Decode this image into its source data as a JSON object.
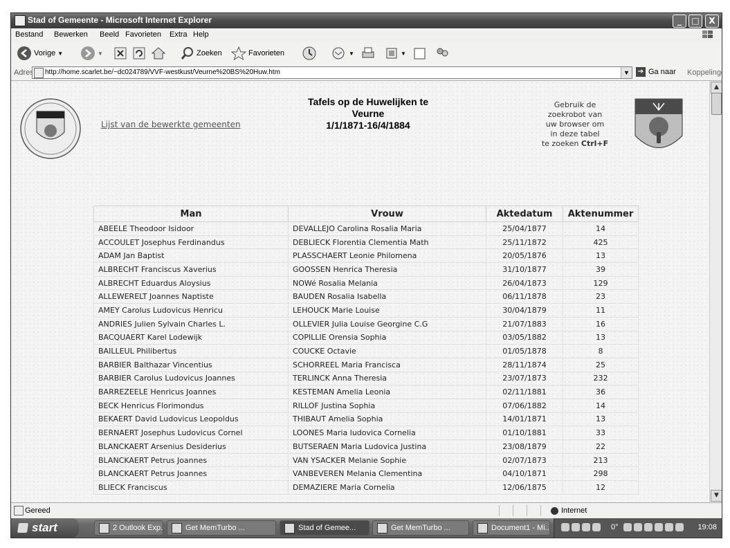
{
  "window": {
    "title": "Stad of  Gemeente - Microsoft Internet Explorer",
    "controls": {
      "minimize": "_",
      "maximize": "□",
      "close": "X"
    }
  },
  "menu": [
    "Bestand",
    "Bewerken",
    "Beeld",
    "Favorieten",
    "Extra",
    "Help"
  ],
  "toolbar": {
    "back_label": "Vorige",
    "search_label": "Zoeken",
    "favorites_label": "Favorieten"
  },
  "address": {
    "label": "Adres",
    "url": "http://home.scarlet.be/~dc024789/VVF-westkust/Veurne%20BS%20Huw.htm",
    "go_label": "Ga naar",
    "links_label": "Koppelingen"
  },
  "page": {
    "link_text": "Lijst van de bewerkte gemeenten",
    "title_line1": "Tafels op de Huwelijken te",
    "title_line2": "Veurne",
    "title_line3": "1/1/1871-16/4/1884",
    "hint_lines": [
      "Gebruik de",
      "zoekrobot van",
      "uw browser om",
      "in deze tabel"
    ],
    "hint_last_prefix": "te zoeken ",
    "hint_shortcut": "Ctrl+F",
    "logo_left_text": "SVVF"
  },
  "table": {
    "headers": [
      "Man",
      "Vrouw",
      "Aktedatum",
      "Aktenummer"
    ],
    "rows": [
      [
        "ABEELE Theodoor Isidoor",
        "DEVALLEJO Carolina Rosalia Maria",
        "25/04/1877",
        "14"
      ],
      [
        "ACCOULET Josephus Ferdinandus",
        "DEBLIECK Florentia Clementia Math",
        "25/11/1872",
        "425"
      ],
      [
        "ADAM Jan Baptist",
        "PLASSCHAERT Leonie Philomena",
        "20/05/1876",
        "13"
      ],
      [
        "ALBRECHT Franciscus Xaverius",
        "GOOSSEN Henrica Theresia",
        "31/10/1877",
        "39"
      ],
      [
        "ALBRECHT Eduardus Aloysius",
        "NOWé Rosalia Melania",
        "26/04/1873",
        "129"
      ],
      [
        "ALLEWERELT Joannes Naptiste",
        "BAUDEN Rosalia Isabella",
        "06/11/1878",
        "23"
      ],
      [
        "AMEY Carolus Ludovicus Henricu",
        "LEHOUCK Marie Louise",
        "30/04/1879",
        "11"
      ],
      [
        "ANDRIES Julien Sylvain Charles L.",
        "OLLEVIER Julia Louise Georgine C.G",
        "21/07/1883",
        "16"
      ],
      [
        "BACQUAERT Karel Lodewijk",
        "COPILLIE Orensia Sophia",
        "03/05/1882",
        "13"
      ],
      [
        "BAILLEUL Philibertus",
        "COUCKE Octavie",
        "01/05/1878",
        "8"
      ],
      [
        "BARBIER Balthazar Vincentius",
        "SCHORREEL Maria Francisca",
        "28/11/1874",
        "25"
      ],
      [
        "BARBIER Carolus Ludovicus Joannes",
        "TERLINCK Anna Theresia",
        "23/07/1873",
        "232"
      ],
      [
        "BARREZEELE Henricus Joannes",
        "KESTEMAN Amelia Leonia",
        "02/11/1881",
        "36"
      ],
      [
        "BECK Henricus Florimondus",
        "RILLOF Justina Sophia",
        "07/06/1882",
        "14"
      ],
      [
        "BEKAERT David Ludovicus Leopoldus",
        "THIBAUT Amelia Sophia",
        "14/01/1871",
        "13"
      ],
      [
        "BERNAERT Josephus Ludovicus Cornel",
        "LOONES Maria ludovica Cornelia",
        "01/10/1881",
        "33"
      ],
      [
        "BLANCKAERT Arsenius Desiderius",
        "BUTSERAEN Maria Ludovica Justina",
        "23/08/1879",
        "22"
      ],
      [
        "BLANCKAERT Petrus Joannes",
        "VAN YSACKER Melanie Sophie",
        "02/07/1873",
        "213"
      ],
      [
        "BLANCKAERT Petrus Joannes",
        "VANBEVEREN Melania Clementina",
        "04/10/1871",
        "298"
      ],
      [
        "BLIECK Franciscus",
        "DEMAZIERE Maria Cornelia",
        "12/06/1875",
        "12"
      ]
    ]
  },
  "status": {
    "text": "Gereed",
    "zone": "Internet"
  },
  "taskbar": {
    "start_label": "start",
    "tasks": [
      {
        "label": "2 Outlook Exp...",
        "active": false
      },
      {
        "label": "Get MemTurbo ...",
        "active": false
      },
      {
        "label": "Stad of  Gemee...",
        "active": true
      },
      {
        "label": "Get MemTurbo ...",
        "active": false
      },
      {
        "label": "Document1 - Mi...",
        "active": false
      }
    ],
    "temperature": "0°",
    "clock": "19:08"
  }
}
